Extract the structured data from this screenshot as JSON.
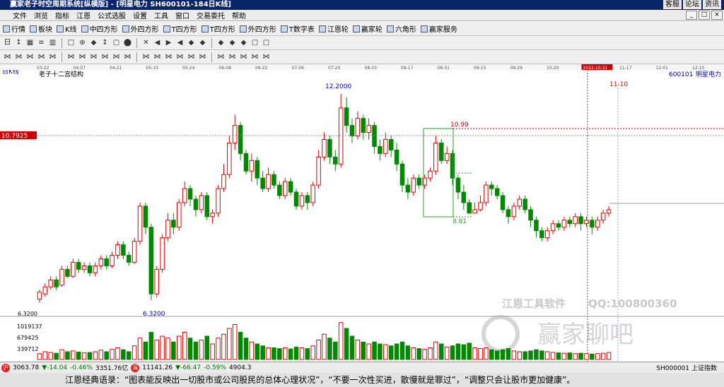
{
  "window": {
    "title": "赢家老子时空周期系统[纵横版] - [明星电力  SH600101-184日K线]",
    "sys_buttons": [
      "客服",
      "论坛",
      "资讯"
    ],
    "win_buttons": [
      "_",
      "□",
      "×"
    ]
  },
  "menu": [
    "文件",
    "浏览",
    "指标",
    "江恩",
    "公式选股",
    "设置",
    "工具",
    "窗口",
    "交易委托",
    "帮助"
  ],
  "toolbar1": [
    "行情",
    "板块",
    "K线",
    "中四方形",
    "外四方形",
    "T四方形",
    "T四方形",
    "外四方形",
    "T数字表",
    "江恩轮",
    "赢家轮",
    "六角形",
    "赢家服务"
  ],
  "toolbar2_icons": [
    "日",
    "↕",
    "▦",
    "≡",
    "▥",
    "□",
    "⊕",
    "◆",
    "↕",
    "▢",
    "⬤",
    "✕",
    "◀",
    "▶",
    "◀",
    "◆",
    "◆",
    "◆",
    "◆",
    "◆",
    "▢",
    "▢"
  ],
  "toolbar3_icons": [
    "⋈",
    "⋈",
    "⋈",
    "⋈",
    "⋈",
    "⋈",
    "⋈",
    "⋈",
    "⋈",
    "⋈",
    "⋈",
    "⋈",
    "⋈",
    "⋈",
    "⋈",
    "⋈",
    "⋈",
    "⋈",
    "⋈",
    "⋈",
    "⋈",
    "⋈"
  ],
  "date_strip": [
    "03-22",
    "04-07",
    "04-21",
    "05-10",
    "05-24",
    "06-08",
    "06-22",
    "07-06",
    "07-20",
    "08-03",
    "08-17",
    "08-31",
    "09-15",
    "09-29",
    "10-20",
    "2022-10-31",
    "11-17",
    "12-01",
    "12-15"
  ],
  "chart": {
    "period_label": "日K线",
    "structure_label": "老子十二宫结构",
    "code": "600101",
    "name": "明星电力",
    "cursor_price": "10.7925",
    "cursor_date": "11-10",
    "annotations": {
      "high": "12.2000",
      "low": "6.3200",
      "box_top": "10.99",
      "box_bottom": "8.81"
    },
    "volume_ticks": [
      "1019137",
      "679425",
      "339712"
    ],
    "price_tick_low": "6.3200"
  },
  "chart_data": {
    "type": "candlestick",
    "title": "",
    "ylim": [
      6.0,
      12.6
    ],
    "candles": [
      [
        6.35,
        6.55,
        6.25,
        6.62
      ],
      [
        6.5,
        6.7,
        6.42,
        6.8
      ],
      [
        6.7,
        6.9,
        6.62,
        7.0
      ],
      [
        6.9,
        6.7,
        6.6,
        7.0
      ],
      [
        6.75,
        7.2,
        6.7,
        7.3
      ],
      [
        7.2,
        7.0,
        6.95,
        7.3
      ],
      [
        7.0,
        7.4,
        6.95,
        7.5
      ],
      [
        7.4,
        7.2,
        7.1,
        7.5
      ],
      [
        7.2,
        7.3,
        7.1,
        7.4
      ],
      [
        7.3,
        7.1,
        7.0,
        7.4
      ],
      [
        7.1,
        7.3,
        7.0,
        7.4
      ],
      [
        7.3,
        7.5,
        7.2,
        7.6
      ],
      [
        7.5,
        7.3,
        7.2,
        7.6
      ],
      [
        7.3,
        7.6,
        7.25,
        7.7
      ],
      [
        7.6,
        7.9,
        7.5,
        8.0
      ],
      [
        7.9,
        7.6,
        7.5,
        8.0
      ],
      [
        7.6,
        7.4,
        7.3,
        7.7
      ],
      [
        7.4,
        8.0,
        7.35,
        8.1
      ],
      [
        8.0,
        9.0,
        7.9,
        9.1
      ],
      [
        9.0,
        8.4,
        8.2,
        9.1
      ],
      [
        8.4,
        6.5,
        6.32,
        8.5
      ],
      [
        6.5,
        7.2,
        6.4,
        7.3
      ],
      [
        7.2,
        8.1,
        7.1,
        8.2
      ],
      [
        8.1,
        8.6,
        8.0,
        8.8
      ],
      [
        8.6,
        8.4,
        8.2,
        8.8
      ],
      [
        8.4,
        9.1,
        8.3,
        9.2
      ],
      [
        9.1,
        9.5,
        9.0,
        9.7
      ],
      [
        9.5,
        9.2,
        9.0,
        9.6
      ],
      [
        9.2,
        8.9,
        8.7,
        9.3
      ],
      [
        8.9,
        9.3,
        8.8,
        9.4
      ],
      [
        9.3,
        8.7,
        8.6,
        9.4
      ],
      [
        8.7,
        8.8,
        8.5,
        8.9
      ],
      [
        8.8,
        9.5,
        8.7,
        9.6
      ],
      [
        9.5,
        9.9,
        9.4,
        10.2
      ],
      [
        9.9,
        10.8,
        9.8,
        11.0
      ],
      [
        10.8,
        11.3,
        10.6,
        11.6
      ],
      [
        11.3,
        10.5,
        10.3,
        11.4
      ],
      [
        10.5,
        10.0,
        9.9,
        10.6
      ],
      [
        10.0,
        10.3,
        9.7,
        10.5
      ],
      [
        10.3,
        9.8,
        9.6,
        10.4
      ],
      [
        9.8,
        9.5,
        9.4,
        10.0
      ],
      [
        9.5,
        9.9,
        9.4,
        10.1
      ],
      [
        9.9,
        9.6,
        9.5,
        10.0
      ],
      [
        9.6,
        9.3,
        9.2,
        9.7
      ],
      [
        9.3,
        9.7,
        9.2,
        9.8
      ],
      [
        9.7,
        9.4,
        9.3,
        9.8
      ],
      [
        9.4,
        9.0,
        8.9,
        9.5
      ],
      [
        9.0,
        9.3,
        8.9,
        9.4
      ],
      [
        9.3,
        9.1,
        8.9,
        9.4
      ],
      [
        9.1,
        9.6,
        9.0,
        9.7
      ],
      [
        9.6,
        10.4,
        9.5,
        10.6
      ],
      [
        10.4,
        10.9,
        10.3,
        11.1
      ],
      [
        10.9,
        10.4,
        10.2,
        11.0
      ],
      [
        10.4,
        10.2,
        10.0,
        10.6
      ],
      [
        10.2,
        11.8,
        10.1,
        12.2
      ],
      [
        11.8,
        11.3,
        11.1,
        12.1
      ],
      [
        11.3,
        11.0,
        10.8,
        11.5
      ],
      [
        11.0,
        11.5,
        10.9,
        11.7
      ],
      [
        11.5,
        11.1,
        10.9,
        11.6
      ],
      [
        11.1,
        11.3,
        10.9,
        11.5
      ],
      [
        11.3,
        10.7,
        10.5,
        11.4
      ],
      [
        10.7,
        10.5,
        10.3,
        10.9
      ],
      [
        10.5,
        10.9,
        10.4,
        11.1
      ],
      [
        10.9,
        10.6,
        10.4,
        11.0
      ],
      [
        10.6,
        10.2,
        10.0,
        10.8
      ],
      [
        10.2,
        9.6,
        9.4,
        10.3
      ],
      [
        9.6,
        9.4,
        9.2,
        9.8
      ],
      [
        9.4,
        9.8,
        9.3,
        9.9
      ],
      [
        9.8,
        9.6,
        9.5,
        9.9
      ],
      [
        9.6,
        9.8,
        9.5,
        9.9
      ],
      [
        9.8,
        10.0,
        9.7,
        10.1
      ],
      [
        10.0,
        10.8,
        9.9,
        11.0
      ],
      [
        10.8,
        10.3,
        10.2,
        10.9
      ],
      [
        10.3,
        10.5,
        10.2,
        10.7
      ],
      [
        10.5,
        9.8,
        9.6,
        10.6
      ],
      [
        9.8,
        9.4,
        9.2,
        9.9
      ],
      [
        9.4,
        9.1,
        8.9,
        9.6
      ],
      [
        9.1,
        8.8,
        8.81,
        9.2
      ],
      [
        8.8,
        8.9,
        8.81,
        9.1
      ],
      [
        8.9,
        9.1,
        8.85,
        9.3
      ],
      [
        9.1,
        9.6,
        9.0,
        9.7
      ],
      [
        9.6,
        9.5,
        9.3,
        9.7
      ],
      [
        9.5,
        9.3,
        9.2,
        9.6
      ],
      [
        9.3,
        8.9,
        8.8,
        9.4
      ],
      [
        8.9,
        8.7,
        8.5,
        9.0
      ],
      [
        8.7,
        9.0,
        8.6,
        9.1
      ],
      [
        9.0,
        9.2,
        8.9,
        9.3
      ],
      [
        9.2,
        8.9,
        8.8,
        9.3
      ],
      [
        8.9,
        8.6,
        8.4,
        9.0
      ],
      [
        8.6,
        8.3,
        8.1,
        8.7
      ],
      [
        8.3,
        8.1,
        8.0,
        8.4
      ],
      [
        8.1,
        8.3,
        8.0,
        8.4
      ],
      [
        8.3,
        8.5,
        8.2,
        8.6
      ],
      [
        8.5,
        8.4,
        8.3,
        8.6
      ],
      [
        8.4,
        8.6,
        8.3,
        8.7
      ],
      [
        8.6,
        8.5,
        8.4,
        8.7
      ],
      [
        8.5,
        8.7,
        8.4,
        8.8
      ],
      [
        8.7,
        8.5,
        8.3,
        8.8
      ],
      [
        8.5,
        8.6,
        8.4,
        8.7
      ],
      [
        8.6,
        8.4,
        8.2,
        8.7
      ],
      [
        8.4,
        8.6,
        8.3,
        8.7
      ],
      [
        8.6,
        8.8,
        8.5,
        8.9
      ],
      [
        8.8,
        8.9,
        8.7,
        9.0
      ]
    ],
    "volumes": [
      0.15,
      0.2,
      0.18,
      0.16,
      0.25,
      0.2,
      0.22,
      0.19,
      0.17,
      0.18,
      0.2,
      0.24,
      0.2,
      0.26,
      0.3,
      0.25,
      0.2,
      0.35,
      0.55,
      0.45,
      0.7,
      0.5,
      0.6,
      0.55,
      0.45,
      0.6,
      0.7,
      0.55,
      0.45,
      0.5,
      0.6,
      0.4,
      0.55,
      0.65,
      0.8,
      0.9,
      0.7,
      0.55,
      0.45,
      0.4,
      0.35,
      0.3,
      0.3,
      0.28,
      0.3,
      0.27,
      0.32,
      0.3,
      0.28,
      0.35,
      0.5,
      0.65,
      0.55,
      0.45,
      0.95,
      0.8,
      0.6,
      0.5,
      0.45,
      0.4,
      0.45,
      0.4,
      0.38,
      0.35,
      0.4,
      0.45,
      0.35,
      0.3,
      0.28,
      0.26,
      0.3,
      0.45,
      0.4,
      0.32,
      0.35,
      0.4,
      0.38,
      0.42,
      0.3,
      0.28,
      0.3,
      0.25,
      0.22,
      0.25,
      0.28,
      0.22,
      0.2,
      0.2,
      0.22,
      0.25,
      0.22,
      0.2,
      0.18,
      0.17,
      0.16,
      0.17,
      0.15,
      0.16,
      0.15,
      0.14,
      0.15,
      0.16,
      0.18
    ]
  },
  "status": {
    "sh_index": "3063.78",
    "sh_change": "▼-14.04",
    "sh_pct": "-0.46%",
    "sh_amount": "3351.76亿",
    "sz_index": "11141.26",
    "sz_change": "▼-66.47",
    "sz_pct": "-0.59%",
    "sz_amount": "4904.3",
    "index_code": "SH000001 上证指数"
  },
  "quote": "江恩经典语录：“图表能反映出一切股市或公司股民的总体心理状况”，“不要一次性买进，散慢就是罪过”，“调整只会让股市更加健康”。",
  "watermark": {
    "company": "江恩工具软件",
    "qq": "QQ:100800360",
    "site": "赢家聊吧"
  }
}
